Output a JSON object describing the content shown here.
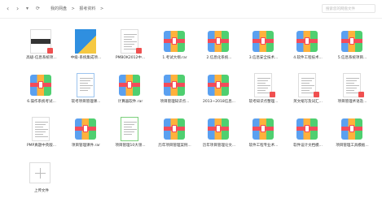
{
  "nav": {
    "back": "‹",
    "forward": "›",
    "refresh": "⟳",
    "dropdown": "▾"
  },
  "breadcrumb": [
    "我的网盘",
    ">",
    "报考资料",
    ">"
  ],
  "search_placeholder": "搜索您的网盘文件",
  "files": [
    {
      "name": "高级-信息系统项...",
      "type": "book_dark"
    },
    {
      "name": "中级-系统集成项...",
      "type": "book_blue"
    },
    {
      "name": "PMBOK2012中...",
      "type": "doc"
    },
    {
      "name": "1.考试大纲.rar",
      "type": "rar"
    },
    {
      "name": "2.信息化系统...",
      "type": "rar"
    },
    {
      "name": "3.信息安全技术...",
      "type": "rar"
    },
    {
      "name": "4.软件工程技术...",
      "type": "rar"
    },
    {
      "name": "5.信息系统项目...",
      "type": "rar"
    },
    {
      "name": "6.操作系统考试...",
      "type": "rar"
    },
    {
      "name": "软考项目管理课...",
      "type": "doc_blue"
    },
    {
      "name": "计算器软件.rar",
      "type": "rar"
    },
    {
      "name": "项目管理知识点...",
      "type": "rar"
    },
    {
      "name": "2013~2018信息...",
      "type": "rar"
    },
    {
      "name": "软考知识点整理...",
      "type": "doc"
    },
    {
      "name": "英文缩写及词汇...",
      "type": "doc"
    },
    {
      "name": "项目管理术语及...",
      "type": "doc"
    },
    {
      "name": "PMP真题中英版...",
      "type": "doc_plain"
    },
    {
      "name": "项目管理课件.rar",
      "type": "rar"
    },
    {
      "name": "项目管理10大领...",
      "type": "doc_green"
    },
    {
      "name": "历年项目管理案例...",
      "type": "rar"
    },
    {
      "name": "历年项目管理论文...",
      "type": "rar"
    },
    {
      "name": "软件工程专业术...",
      "type": "rar"
    },
    {
      "name": "软件设计文档模...",
      "type": "rar"
    },
    {
      "name": "项目管理工具模板...",
      "type": "rar"
    }
  ],
  "upload_label": "上传文件"
}
